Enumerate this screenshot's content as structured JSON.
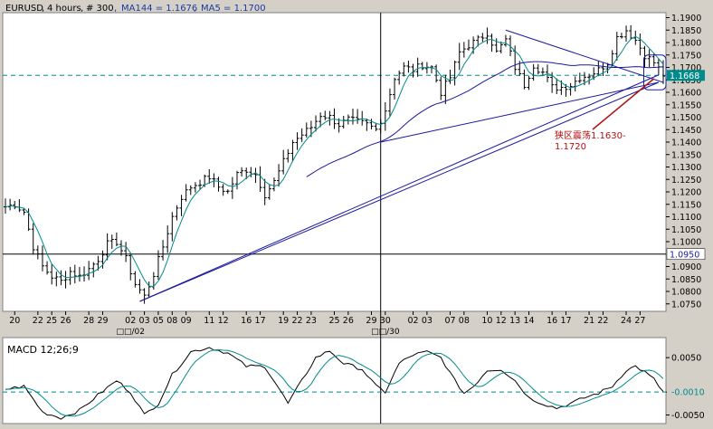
{
  "header": {
    "symbol": "EURUSD",
    "timeframe": "4 hours",
    "bars": "# 300",
    "ma144_label": "MA144 = 1.1676",
    "ma5_label": "MA5 = 1.1700"
  },
  "annotation": {
    "line1": "狭区震荡1.1630-",
    "line2": "1.1720"
  },
  "colors": {
    "background": "#d4d0c8",
    "plot_bg": "#ffffff",
    "price": "#000000",
    "ma_fast": "#008b8b",
    "ma_slow": "#1a1aa0",
    "trendline": "#1a1aa0",
    "dashed_level": "#008b8b",
    "annotation": "#b01010",
    "header_text": "#000000",
    "header_ma": "#1a3aa0",
    "highlight_box": "#1a1aa0"
  },
  "chart_data": [
    {
      "type": "line",
      "panel": "price",
      "title": "",
      "ylim": [
        1.072,
        1.192
      ],
      "y_ticks": [
        "1.1900",
        "1.1850",
        "1.1800",
        "1.1750",
        "1.1700",
        "1.1650",
        "1.1600",
        "1.1550",
        "1.1500",
        "1.1450",
        "1.1400",
        "1.1350",
        "1.1300",
        "1.1250",
        "1.1200",
        "1.1150",
        "1.1100",
        "1.1050",
        "1.1000",
        "1.0900",
        "1.0850",
        "1.0800",
        "1.0750"
      ],
      "y_tick_values": [
        1.19,
        1.185,
        1.18,
        1.175,
        1.17,
        1.165,
        1.16,
        1.155,
        1.15,
        1.145,
        1.14,
        1.135,
        1.13,
        1.125,
        1.12,
        1.115,
        1.11,
        1.105,
        1.1,
        1.09,
        1.085,
        1.08,
        1.075
      ],
      "x_ticks": [
        "20",
        "22",
        "25",
        "26",
        "28",
        "29",
        "02",
        "03",
        "05",
        "08",
        "09",
        "11",
        "12",
        "16",
        "17",
        "19",
        "22",
        "23",
        "25",
        "26",
        "29",
        "30",
        "02",
        "03",
        "07",
        "08",
        "10",
        "12",
        "13",
        "14",
        "16",
        "17",
        "21",
        "22",
        "24",
        "27"
      ],
      "x_tick_positions": [
        2,
        7,
        10,
        13,
        18,
        21,
        27,
        30,
        33,
        36,
        39,
        44,
        47,
        52,
        55,
        60,
        63,
        66,
        71,
        74,
        79,
        82,
        88,
        91,
        96,
        99,
        104,
        107,
        110,
        113,
        118,
        121,
        126,
        129,
        134,
        137
      ],
      "x_sublabels": [
        {
          "text": "□□/02",
          "position": 27
        },
        {
          "text": "□□/30",
          "position": 82
        }
      ],
      "price_anchors": [
        [
          0,
          1.114
        ],
        [
          2,
          1.115
        ],
        [
          4,
          1.112
        ],
        [
          6,
          1.098
        ],
        [
          8,
          1.09
        ],
        [
          10,
          1.086
        ],
        [
          12,
          1.084
        ],
        [
          14,
          1.088
        ],
        [
          16,
          1.086
        ],
        [
          18,
          1.089
        ],
        [
          20,
          1.093
        ],
        [
          22,
          1.099
        ],
        [
          24,
          1.1
        ],
        [
          26,
          1.093
        ],
        [
          28,
          1.083
        ],
        [
          30,
          1.078
        ],
        [
          32,
          1.087
        ],
        [
          34,
          1.098
        ],
        [
          36,
          1.11
        ],
        [
          38,
          1.118
        ],
        [
          40,
          1.122
        ],
        [
          42,
          1.124
        ],
        [
          44,
          1.126
        ],
        [
          46,
          1.122
        ],
        [
          48,
          1.12
        ],
        [
          50,
          1.127
        ],
        [
          52,
          1.129
        ],
        [
          54,
          1.127
        ],
        [
          56,
          1.119
        ],
        [
          58,
          1.124
        ],
        [
          60,
          1.132
        ],
        [
          62,
          1.14
        ],
        [
          64,
          1.143
        ],
        [
          66,
          1.146
        ],
        [
          68,
          1.151
        ],
        [
          70,
          1.15
        ],
        [
          72,
          1.147
        ],
        [
          74,
          1.149
        ],
        [
          76,
          1.148
        ],
        [
          78,
          1.147
        ],
        [
          80,
          1.145
        ],
        [
          82,
          1.153
        ],
        [
          84,
          1.166
        ],
        [
          86,
          1.17
        ],
        [
          88,
          1.169
        ],
        [
          90,
          1.171
        ],
        [
          92,
          1.17
        ],
        [
          94,
          1.16
        ],
        [
          96,
          1.166
        ],
        [
          98,
          1.176
        ],
        [
          100,
          1.179
        ],
        [
          102,
          1.181
        ],
        [
          104,
          1.184
        ],
        [
          106,
          1.176
        ],
        [
          108,
          1.181
        ],
        [
          110,
          1.17
        ],
        [
          112,
          1.163
        ],
        [
          114,
          1.171
        ],
        [
          116,
          1.168
        ],
        [
          118,
          1.162
        ],
        [
          120,
          1.162
        ],
        [
          122,
          1.163
        ],
        [
          124,
          1.166
        ],
        [
          126,
          1.167
        ],
        [
          128,
          1.169
        ],
        [
          130,
          1.172
        ],
        [
          132,
          1.182
        ],
        [
          134,
          1.185
        ],
        [
          136,
          1.181
        ],
        [
          138,
          1.175
        ],
        [
          140,
          1.172
        ],
        [
          142,
          1.167
        ]
      ],
      "resistance_line": {
        "from": [
          108,
          1.185
        ],
        "to": [
          142,
          1.164
        ]
      },
      "trendline_main": {
        "from": [
          29,
          1.076
        ],
        "to": [
          141,
          1.164
        ]
      },
      "trendline_second": {
        "from": [
          81,
          1.14
        ],
        "to": [
          141,
          1.164
        ]
      },
      "trendline_third": {
        "from": [
          29,
          1.076
        ],
        "to": [
          141,
          1.167
        ]
      },
      "ma144_start": 65,
      "dashed_level": {
        "value": 1.1668,
        "label": "1.1668"
      },
      "solid_level": {
        "value": 1.095,
        "label": "1.0950"
      },
      "vertical_marker": 81,
      "highlight_box": {
        "x": [
          138,
          142
        ],
        "y": [
          1.161,
          1.175
        ]
      },
      "annotation_target": [
        140,
        1.1655
      ]
    },
    {
      "type": "line",
      "panel": "macd",
      "title": "MACD 12;26;9",
      "ylim": [
        -0.0065,
        0.0085
      ],
      "y_ticks": [
        "0.0050",
        "-0.0010",
        "-0.0050"
      ],
      "y_tick_values": [
        0.005,
        -0.001,
        -0.005
      ],
      "dashed_level": -0.001,
      "macd_anchors": [
        [
          0,
          -0.0005
        ],
        [
          4,
          0.0
        ],
        [
          8,
          -0.0045
        ],
        [
          12,
          -0.0055
        ],
        [
          16,
          -0.0042
        ],
        [
          20,
          -0.0015
        ],
        [
          24,
          0.001
        ],
        [
          27,
          -0.001
        ],
        [
          30,
          -0.005
        ],
        [
          33,
          -0.003
        ],
        [
          36,
          0.002
        ],
        [
          40,
          0.006
        ],
        [
          44,
          0.0068
        ],
        [
          48,
          0.0058
        ],
        [
          52,
          0.0035
        ],
        [
          56,
          0.0035
        ],
        [
          58,
          0.001
        ],
        [
          61,
          -0.003
        ],
        [
          64,
          0.001
        ],
        [
          67,
          0.005
        ],
        [
          70,
          0.0062
        ],
        [
          73,
          0.004
        ],
        [
          77,
          0.003
        ],
        [
          80,
          0.0
        ],
        [
          82,
          -0.001
        ],
        [
          85,
          0.004
        ],
        [
          88,
          0.0055
        ],
        [
          91,
          0.006
        ],
        [
          94,
          0.005
        ],
        [
          97,
          0.001
        ],
        [
          99,
          -0.0012
        ],
        [
          101,
          0.0
        ],
        [
          104,
          0.0028
        ],
        [
          107,
          0.003
        ],
        [
          110,
          0.001
        ],
        [
          113,
          -0.002
        ],
        [
          116,
          -0.003
        ],
        [
          119,
          -0.0038
        ],
        [
          122,
          -0.003
        ],
        [
          125,
          -0.002
        ],
        [
          128,
          -0.0012
        ],
        [
          131,
          0.0
        ],
        [
          134,
          0.0028
        ],
        [
          136,
          0.0035
        ],
        [
          138,
          0.0025
        ],
        [
          140,
          0.0012
        ],
        [
          142,
          -0.001
        ]
      ]
    }
  ]
}
